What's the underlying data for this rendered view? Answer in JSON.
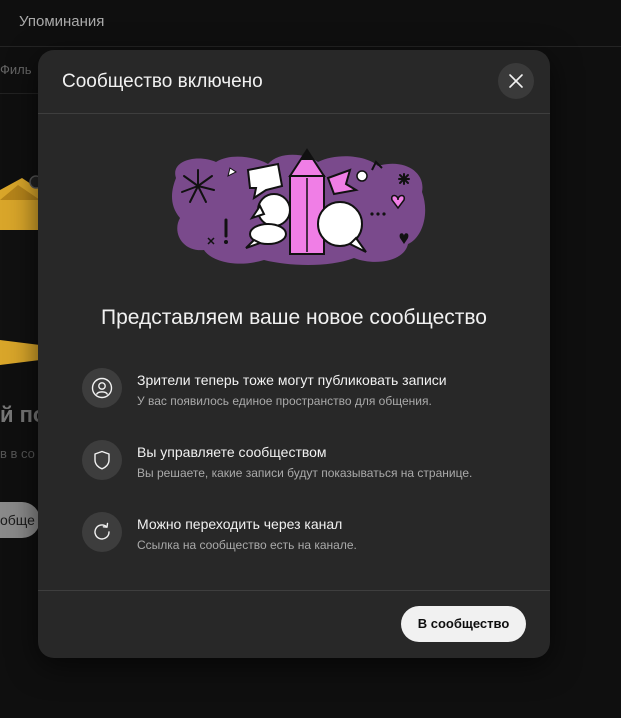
{
  "background": {
    "tab_label": "Упоминания",
    "filter_label": "Филь",
    "heading": "й по",
    "subtext": "в в со",
    "button_label": "обще"
  },
  "modal": {
    "title": "Сообщество включено",
    "headline": "Представляем ваше новое сообщество",
    "features": [
      {
        "icon": "person-icon",
        "title": "Зрители теперь тоже могут публиковать записи",
        "description": "У вас появилось единое пространство для общения."
      },
      {
        "icon": "shield-icon",
        "title": "Вы управляете сообществом",
        "description": "Вы решаете, какие записи будут показываться на странице."
      },
      {
        "icon": "refresh-icon",
        "title": "Можно переходить через канал",
        "description": "Ссылка на сообщество есть на канале."
      }
    ],
    "cta_label": "В сообщество"
  },
  "colors": {
    "modal_background": "#282828",
    "illustration_purple": "#7a4a8c",
    "illustration_pink": "#f07ee6",
    "button_background": "#f1f1f1"
  }
}
